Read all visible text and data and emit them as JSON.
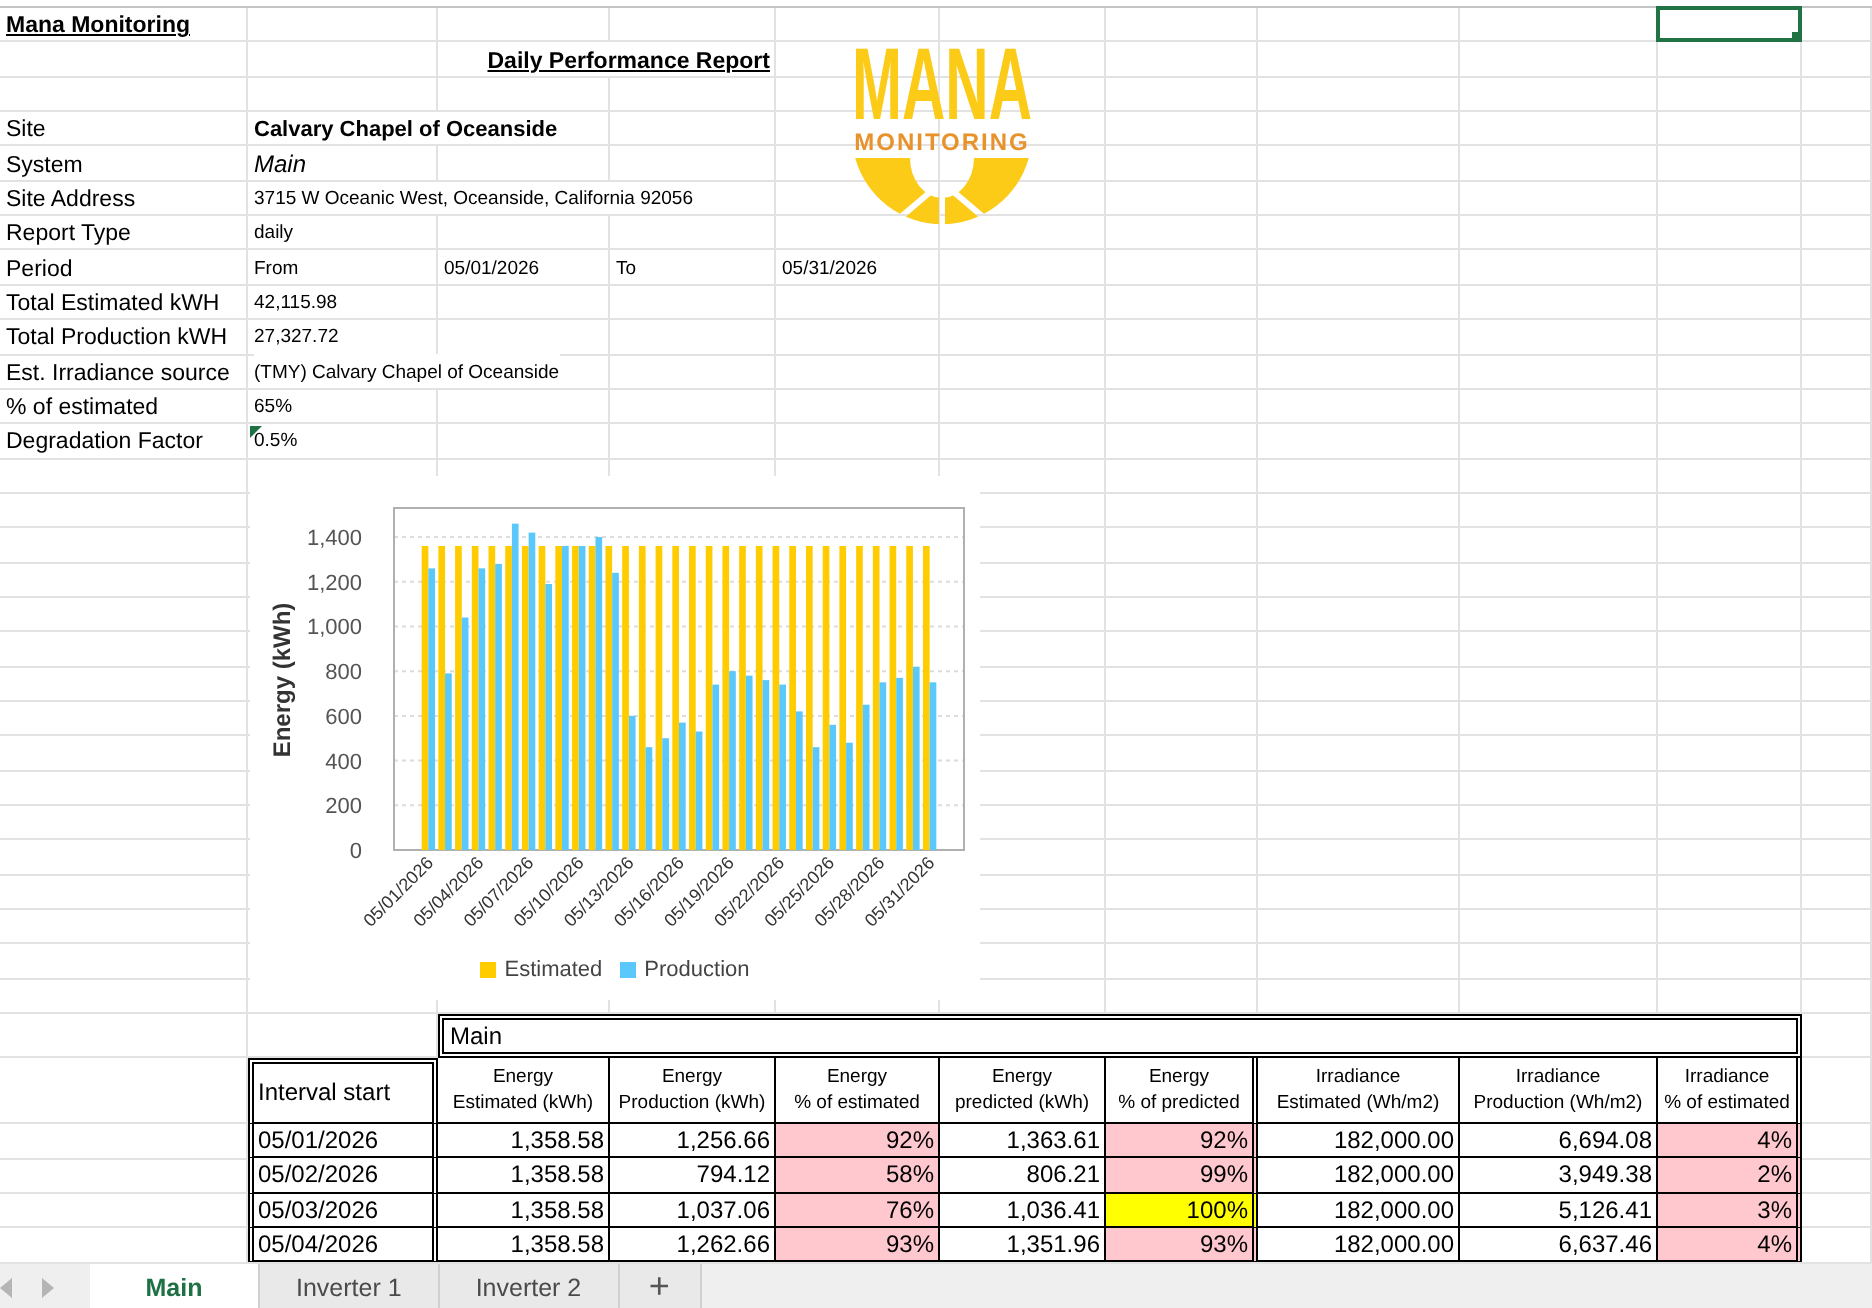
{
  "header": {
    "title": "Mana Monitoring",
    "report_title": "Daily Performance Report"
  },
  "logo": {
    "wordmark": "MANA",
    "tagline": "MONITORING"
  },
  "info_rows": [
    {
      "label": "Site",
      "cells": [
        "Calvary Chapel of Oceanside"
      ],
      "kind": "bold",
      "warning": false
    },
    {
      "label": "System",
      "cells": [
        "Main"
      ],
      "kind": "italic",
      "warning": false
    },
    {
      "label": "Site Address",
      "cells": [
        "3715 W Oceanic West, Oceanside, California 92056"
      ],
      "kind": "plain",
      "warning": false
    },
    {
      "label": "Report Type",
      "cells": [
        "daily"
      ],
      "kind": "plain",
      "warning": false
    },
    {
      "label": "Period",
      "cells": [
        "From",
        "05/01/2026",
        "To",
        "05/31/2026"
      ],
      "kind": "plain",
      "warning": false
    },
    {
      "label": "Total Estimated kWH",
      "cells": [
        "42,115.98"
      ],
      "kind": "plain",
      "warning": false
    },
    {
      "label": "Total Production kWH",
      "cells": [
        "27,327.72"
      ],
      "kind": "plain",
      "warning": false
    },
    {
      "label": "Est. Irradiance source",
      "cells": [
        "(TMY) Calvary Chapel of Oceanside"
      ],
      "kind": "plain",
      "warning": false
    },
    {
      "label": "% of estimated",
      "cells": [
        "65%"
      ],
      "kind": "plain",
      "warning": false
    },
    {
      "label": "Degradation Factor",
      "cells": [
        "0.5%"
      ],
      "kind": "plain",
      "warning": true
    }
  ],
  "chart": {
    "chart_data": {
      "type": "bar",
      "ylabel": "Energy (kWh)",
      "categories": [
        "05/01/2026",
        null,
        null,
        "05/04/2026",
        null,
        null,
        "05/07/2026",
        null,
        null,
        "05/10/2026",
        null,
        null,
        "05/13/2026",
        null,
        null,
        "05/16/2026",
        null,
        null,
        "05/19/2026",
        null,
        null,
        "05/22/2026",
        null,
        null,
        "05/25/2026",
        null,
        null,
        "05/28/2026",
        null,
        null,
        "05/31/2026"
      ],
      "series": [
        {
          "name": "Estimated",
          "color": "#ffcc00",
          "values": [
            1360,
            1360,
            1360,
            1360,
            1360,
            1360,
            1360,
            1360,
            1360,
            1360,
            1360,
            1360,
            1360,
            1360,
            1360,
            1360,
            1360,
            1360,
            1360,
            1360,
            1360,
            1360,
            1360,
            1360,
            1360,
            1360,
            1360,
            1360,
            1360,
            1360,
            1360
          ]
        },
        {
          "name": "Production",
          "color": "#5ac8fa",
          "values": [
            1260,
            790,
            1040,
            1260,
            1280,
            1460,
            1420,
            1190,
            1360,
            1360,
            1400,
            1240,
            600,
            460,
            500,
            570,
            530,
            740,
            800,
            780,
            760,
            740,
            620,
            460,
            560,
            480,
            650,
            750,
            770,
            820,
            750
          ]
        }
      ],
      "ylim": [
        0,
        1530
      ],
      "yticks": [
        0,
        200,
        400,
        600,
        800,
        {
          "value": 1000,
          "label": "1,000"
        },
        {
          "value": 1200,
          "label": "1,200"
        },
        {
          "value": 1400,
          "label": "1,400"
        }
      ],
      "grid": true,
      "legend": "bottom"
    }
  },
  "table": {
    "title": "Main",
    "columns": [
      "Interval start",
      "Energy\nEstimated (kWh)",
      "Energy\nProduction (kWh)",
      "Energy\n% of estimated",
      "Energy\npredicted (kWh)",
      "Energy\n% of predicted",
      "Irradiance\nEstimated (Wh/m2)",
      "Irradiance\nProduction (Wh/m2)",
      "Irradiance\n% of estimated"
    ],
    "rows": [
      {
        "cells": [
          {
            "text": "05/01/2026"
          },
          {
            "text": "1,358.58"
          },
          {
            "text": "1,256.66"
          },
          {
            "text": "92%",
            "color": "#ffc7ce"
          },
          {
            "text": "1,363.61"
          },
          {
            "text": "92%",
            "color": "#ffc7ce"
          },
          {
            "text": "182,000.00"
          },
          {
            "text": "6,694.08"
          },
          {
            "text": "4%",
            "color": "#ffc7ce"
          }
        ]
      },
      {
        "cells": [
          {
            "text": "05/02/2026"
          },
          {
            "text": "1,358.58"
          },
          {
            "text": "794.12"
          },
          {
            "text": "58%",
            "color": "#ffc7ce"
          },
          {
            "text": "806.21"
          },
          {
            "text": "99%",
            "color": "#ffc7ce"
          },
          {
            "text": "182,000.00"
          },
          {
            "text": "3,949.38"
          },
          {
            "text": "2%",
            "color": "#ffc7ce"
          }
        ]
      },
      {
        "cells": [
          {
            "text": "05/03/2026"
          },
          {
            "text": "1,358.58"
          },
          {
            "text": "1,037.06"
          },
          {
            "text": "76%",
            "color": "#ffc7ce"
          },
          {
            "text": "1,036.41"
          },
          {
            "text": "100%",
            "color": "#ffff00"
          },
          {
            "text": "182,000.00"
          },
          {
            "text": "5,126.41"
          },
          {
            "text": "3%",
            "color": "#ffc7ce"
          }
        ]
      },
      {
        "cells": [
          {
            "text": "05/04/2026"
          },
          {
            "text": "1,358.58"
          },
          {
            "text": "1,262.66"
          },
          {
            "text": "93%",
            "color": "#ffc7ce"
          },
          {
            "text": "1,351.96"
          },
          {
            "text": "93%",
            "color": "#ffc7ce"
          },
          {
            "text": "182,000.00"
          },
          {
            "text": "6,637.46"
          },
          {
            "text": "4%",
            "color": "#ffc7ce"
          }
        ]
      }
    ]
  },
  "tabs": [
    {
      "label": "Main",
      "selected": true
    },
    {
      "label": "Inverter 1",
      "selected": false
    },
    {
      "label": "Inverter 2",
      "selected": false
    }
  ],
  "add_tab": "+"
}
